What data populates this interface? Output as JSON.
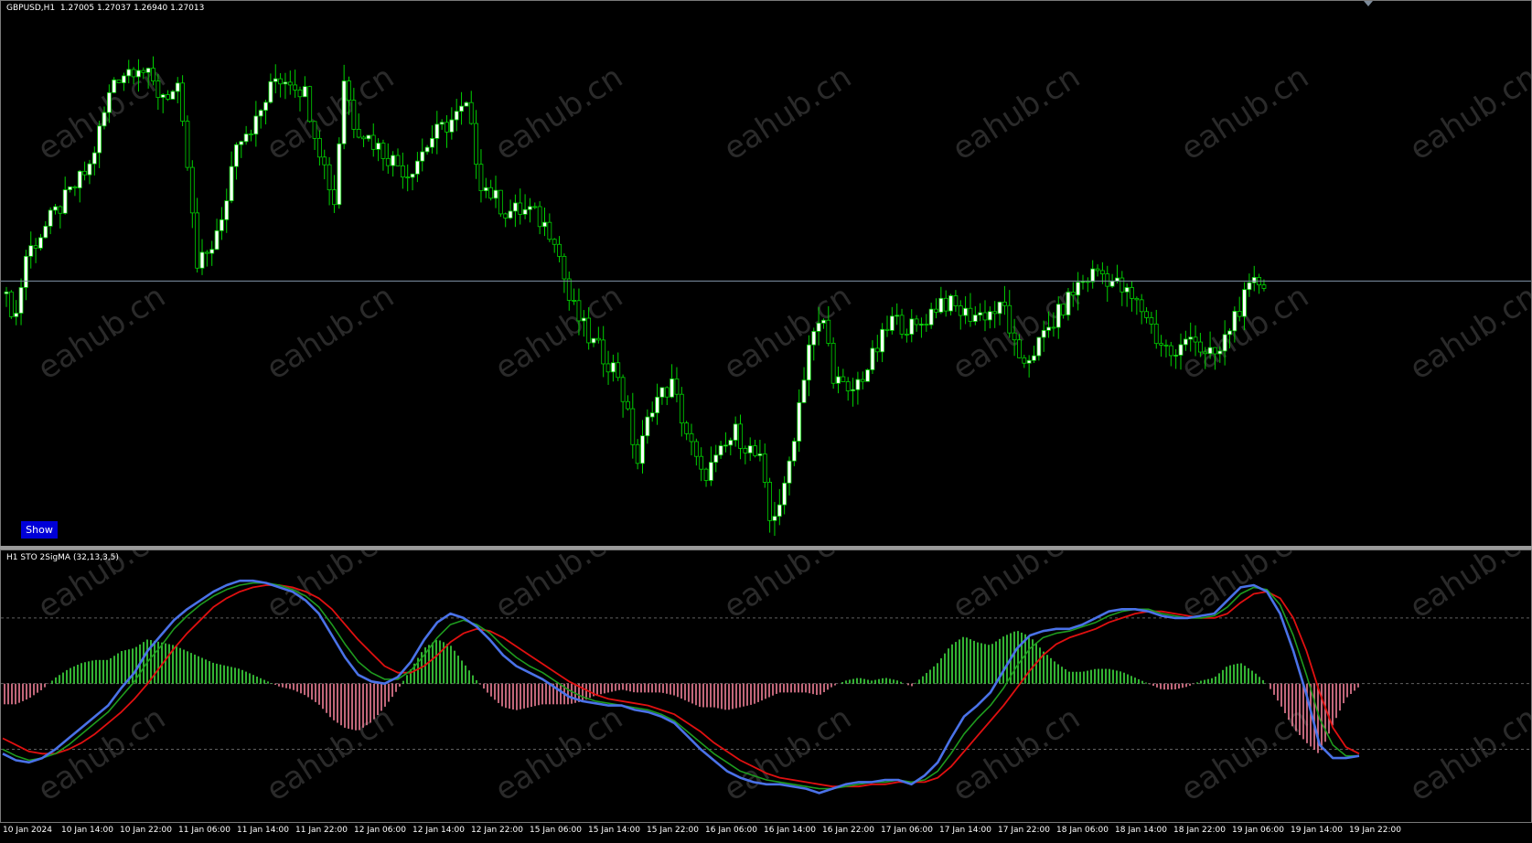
{
  "main": {
    "symbol": "GBPUSD,H1",
    "ohlc": "1.27005 1.27037 1.26940 1.27013",
    "show_button": "Show",
    "price_min": 1.2615,
    "price_max": 1.279,
    "current_price": 1.27013,
    "candle_color": "#00d200",
    "up_body_color": "#ffffff",
    "down_body_color": "#000000",
    "price_line_color": "#8095a8"
  },
  "indicator": {
    "title": "H1 STO 2SigMA (32,13,3,5)",
    "levels": [
      80,
      50,
      20
    ],
    "colors": {
      "main_line": "#4a72e8",
      "signal_green": "#1e9b1e",
      "signal_red": "#e01010",
      "hist_pos": "#40e040",
      "hist_neg": "#f08098",
      "level_line": "#606060"
    }
  },
  "watermark": "eahub.cn",
  "time_axis": [
    "10 Jan 2024",
    "10 Jan 14:00",
    "10 Jan 22:00",
    "11 Jan 06:00",
    "11 Jan 14:00",
    "11 Jan 22:00",
    "12 Jan 06:00",
    "12 Jan 14:00",
    "12 Jan 22:00",
    "15 Jan 06:00",
    "15 Jan 14:00",
    "15 Jan 22:00",
    "16 Jan 06:00",
    "16 Jan 14:00",
    "16 Jan 22:00",
    "17 Jan 06:00",
    "17 Jan 14:00",
    "17 Jan 22:00",
    "18 Jan 06:00",
    "18 Jan 14:00",
    "18 Jan 22:00",
    "19 Jan 06:00",
    "19 Jan 14:00",
    "19 Jan 22:00"
  ],
  "stoch_main": [
    18,
    15,
    14,
    16,
    20,
    25,
    30,
    35,
    40,
    48,
    55,
    65,
    72,
    79,
    84,
    88,
    92,
    95,
    97,
    97,
    96,
    94,
    92,
    88,
    82,
    72,
    62,
    54,
    51,
    50,
    53,
    60,
    70,
    78,
    82,
    80,
    76,
    70,
    63,
    58,
    55,
    52,
    48,
    44,
    42,
    41,
    40,
    40,
    38,
    37,
    35,
    32,
    26,
    20,
    15,
    10,
    7,
    5,
    4,
    4,
    3,
    2,
    0,
    2,
    4,
    5,
    5,
    6,
    6,
    4,
    8,
    14,
    25,
    35,
    40,
    46,
    56,
    66,
    72,
    74,
    75,
    75,
    77,
    80,
    83,
    84,
    84,
    83,
    81,
    80,
    80,
    81,
    82,
    88,
    94,
    95,
    92,
    82,
    65,
    45,
    22,
    16,
    16,
    17
  ],
  "stoch_green": [
    20,
    17,
    15,
    16,
    18,
    22,
    27,
    32,
    37,
    44,
    51,
    60,
    67,
    75,
    81,
    86,
    90,
    93,
    95,
    96,
    96,
    95,
    93,
    90,
    85,
    77,
    68,
    60,
    55,
    52,
    52,
    56,
    63,
    71,
    77,
    79,
    77,
    73,
    67,
    62,
    58,
    55,
    51,
    47,
    44,
    42,
    41,
    40,
    39,
    38,
    36,
    33,
    28,
    23,
    18,
    14,
    10,
    8,
    6,
    5,
    4,
    3,
    2,
    2,
    3,
    4,
    5,
    5,
    6,
    5,
    6,
    10,
    18,
    27,
    34,
    40,
    48,
    58,
    66,
    71,
    73,
    74,
    76,
    78,
    81,
    83,
    84,
    84,
    82,
    81,
    80,
    80,
    81,
    85,
    91,
    94,
    93,
    86,
    72,
    54,
    34,
    22,
    17,
    17
  ],
  "stoch_red": [
    25,
    22,
    19,
    18,
    18,
    20,
    23,
    27,
    32,
    37,
    43,
    50,
    58,
    66,
    73,
    79,
    85,
    89,
    92,
    94,
    95,
    95,
    94,
    92,
    89,
    84,
    77,
    70,
    64,
    58,
    55,
    55,
    58,
    63,
    69,
    73,
    75,
    74,
    71,
    67,
    63,
    59,
    55,
    51,
    48,
    45,
    43,
    42,
    41,
    40,
    38,
    36,
    32,
    28,
    23,
    19,
    15,
    12,
    9,
    7,
    6,
    5,
    4,
    3,
    3,
    3,
    4,
    4,
    5,
    5,
    5,
    7,
    12,
    19,
    26,
    33,
    40,
    48,
    56,
    63,
    68,
    71,
    73,
    75,
    78,
    80,
    82,
    83,
    83,
    82,
    81,
    80,
    80,
    82,
    87,
    91,
    92,
    89,
    80,
    65,
    46,
    30,
    21,
    18
  ]
}
